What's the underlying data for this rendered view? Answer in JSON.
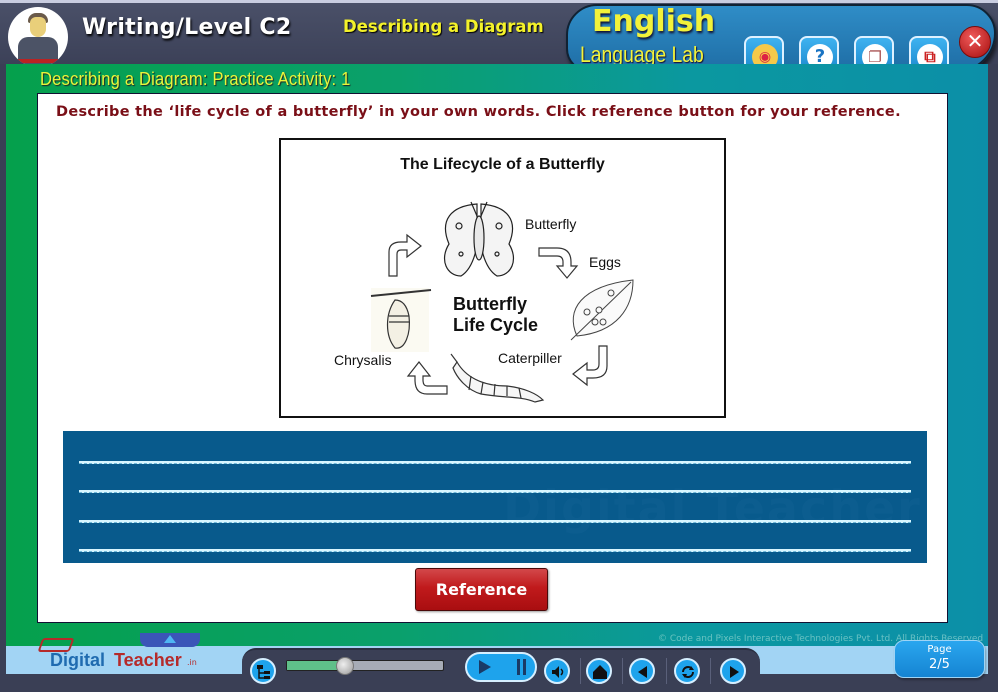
{
  "header": {
    "level_title": "Writing/Level C2",
    "topic_title": "Describing a Diagram",
    "brand_line1": "English",
    "brand_line2": "Language Lab",
    "tools": [
      {
        "name": "camera-icon",
        "glyph": "◉"
      },
      {
        "name": "help-icon",
        "glyph": "?"
      },
      {
        "name": "book-icon",
        "glyph": "❐"
      },
      {
        "name": "window-icon",
        "glyph": "⧉"
      }
    ],
    "close_glyph": "✕"
  },
  "activity": {
    "title": "Describing a Diagram: Practice Activity: 1",
    "instruction": "Describe the ‘life cycle of a butterfly’ in your own words. Click reference button for your reference."
  },
  "diagram": {
    "title": "The Lifecycle of a Butterfly",
    "center_line1": "Butterfly",
    "center_line2": "Life Cycle",
    "stages": [
      "Butterfly",
      "Eggs",
      "Caterpiller",
      "Chrysalis"
    ]
  },
  "writing_area": {
    "line_count": 4,
    "watermark": "Digital Teacher"
  },
  "reference_button": "Reference",
  "footer": {
    "logo_part1": "Digital",
    "logo_part2": "Teacher",
    "logo_suffix": ".in",
    "copyright": "© Code and Pixels Interactive Technologies Pvt. Ltd. All Rights Reserved",
    "progress_fraction": 0.37,
    "page_label": "Page",
    "page_value": "2/5"
  }
}
